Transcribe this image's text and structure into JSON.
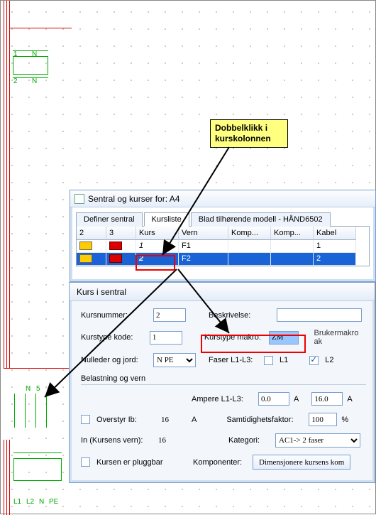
{
  "callout": {
    "line1": "Dobbelklikk i",
    "line2": "kurskolonnen"
  },
  "dialog1": {
    "title": "Sentral og kurser for: A4",
    "tabs": {
      "t1": "Definer sentral",
      "t2": "Kursliste",
      "t3": "Blad tilhørende modell - HÅND6502"
    },
    "headers": {
      "c1": "2",
      "c2": "3",
      "c3": "Kurs",
      "c4": "Vern",
      "c5": "Komp...",
      "c6": "Komp...",
      "c7": "Kabel"
    },
    "rows": [
      {
        "kurs": "1",
        "vern": "F1",
        "kabel": "1"
      },
      {
        "kurs": "2",
        "vern": "F2",
        "kabel": "2"
      }
    ]
  },
  "dialog2": {
    "title": "Kurs i sentral",
    "labels": {
      "kursnummer": "Kursnummer:",
      "beskrivelse": "Beskrivelse:",
      "kurstype_kode": "Kurstype kode:",
      "kurstype_makro": "Kurstype makro:",
      "brukermakro": "Brukermakro ak",
      "nulleder": "Nulleder og jord:",
      "faser": "Faser L1-L3:",
      "l1": "L1",
      "l2": "L2",
      "belastning": "Belastning og vern",
      "ampere": "Ampere L1-L3:",
      "a": "A",
      "overstyr": "Overstyr Ib:",
      "samtidighet": "Samtidighetsfaktor:",
      "pct": "%",
      "in_kurs": "In (Kursens vern):",
      "kategori": "Kategori:",
      "pluggbar": "Kursen er pluggbar",
      "komponenter": "Komponenter:",
      "dimensjonere": "Dimensjonere kursens kom"
    },
    "values": {
      "kursnummer": "2",
      "kurstype_kode": "1",
      "kurstype_makro": "ZM",
      "nulleder": "N PE",
      "amp1": "0.0",
      "amp2": "16.0",
      "overstyr_ib": "16",
      "samtidighet": "100",
      "in_kurs": "16",
      "kategori": "AC1-> 2 faser"
    }
  },
  "schematic": {
    "top": {
      "l1": "1",
      "n": "N"
    },
    "row2": {
      "l1": "2",
      "n": "N"
    },
    "mid": {
      "n": "N",
      "five": "5"
    },
    "bot": {
      "l1": "L1",
      "l2": "L2",
      "n": "N",
      "pe": "PE"
    }
  }
}
